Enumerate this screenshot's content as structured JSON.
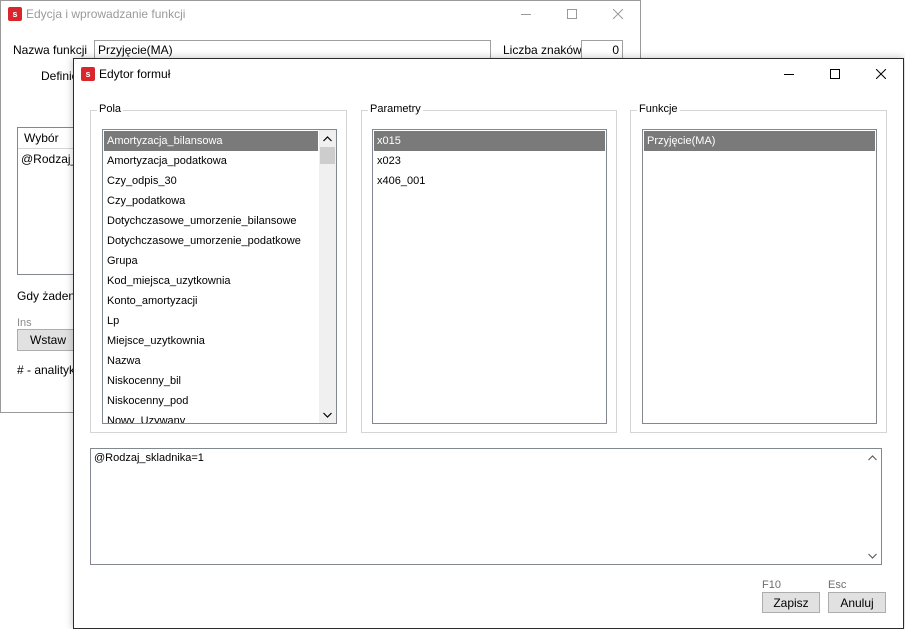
{
  "bg_window": {
    "title": "Edycja i wprowadzanie funkcji",
    "app_icon_glyph": "s",
    "name_label": "Nazwa funkcji",
    "name_value": "Przyjęcie(MA)",
    "chars_label": "Liczba znaków",
    "chars_value": "0",
    "definition_label": "Definic",
    "grid_header": "Wybór",
    "grid_row": "@Rodzaj_s",
    "gdy_text": "Gdy żaden",
    "ins_hint": "Ins",
    "insert_button": "Wstaw",
    "analytics_text": "# - analityka"
  },
  "dialog": {
    "title": "Edytor formuł",
    "app_icon_glyph": "s",
    "pola": {
      "title": "Pola",
      "items": [
        "Amortyzacja_bilansowa",
        "Amortyzacja_podatkowa",
        "Czy_odpis_30",
        "Czy_podatkowa",
        "Dotychczasowe_umorzenie_bilansowe",
        "Dotychczasowe_umorzenie_podatkowe",
        "Grupa",
        "Kod_miejsca_uzytkownia",
        "Konto_amortyzacji",
        "Lp",
        "Miejsce_uzytkownia",
        "Nazwa",
        "Niskocenny_bil",
        "Niskocenny_pod",
        "Nowy_Uzywany"
      ]
    },
    "parametry": {
      "title": "Parametry",
      "items": [
        "x015",
        "x023",
        "x406_001"
      ]
    },
    "funkcje": {
      "title": "Funkcje",
      "items": [
        "Przyjęcie(MA)"
      ]
    },
    "formula": "@Rodzaj_skladnika=1",
    "save_hint": "F10",
    "save_button": "Zapisz",
    "cancel_hint": "Esc",
    "cancel_button": "Anuluj"
  },
  "colors": {
    "brand": "#d9262c",
    "selection": "#7a7a7a",
    "dialog_border": "#2b2b2b"
  }
}
